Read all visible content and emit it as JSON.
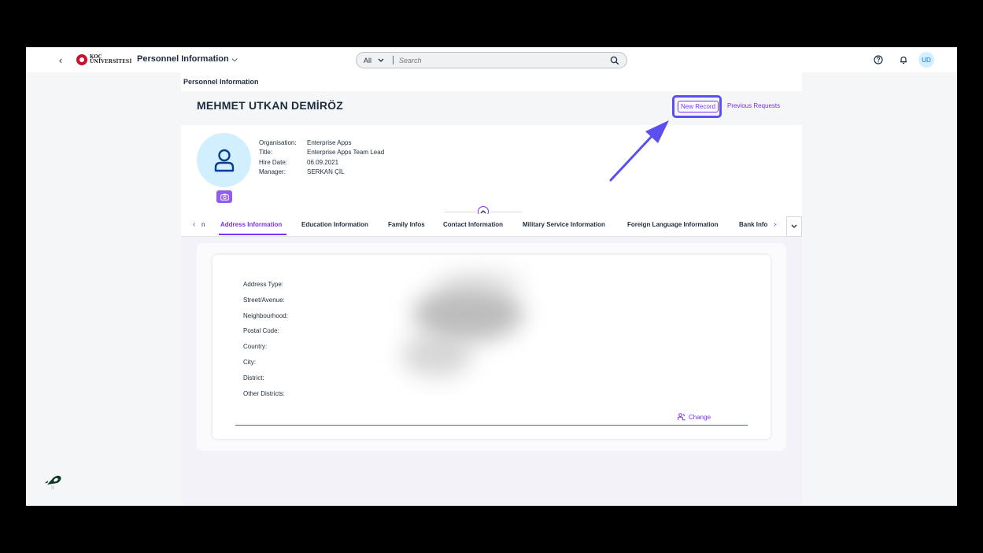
{
  "shell": {
    "logo_line1": "KOÇ",
    "logo_line2": "ÜNİVERSİTESİ",
    "app_title": "Personnel Information",
    "search_scope": "All",
    "search_placeholder": "Search",
    "avatar_initials": "UD"
  },
  "page": {
    "breadcrumb": "Personnel Information",
    "employee_name": "MEHMET UTKAN DEMİRÖZ",
    "actions": {
      "new_record": "New Record",
      "previous_requests": "Previous Requests"
    },
    "facts": [
      {
        "label": "Organisation:",
        "value": "Enterprise Apps"
      },
      {
        "label": "Title:",
        "value": "Enterprise Apps Team Lead"
      },
      {
        "label": "Hire Date:",
        "value": "06.09.2021"
      },
      {
        "label": "Manager:",
        "value": "SERKAN ÇİL"
      }
    ]
  },
  "tabs": {
    "prev_partial": "n",
    "items": [
      "Address Information",
      "Education Information",
      "Family Infos",
      "Contact Information",
      "Military Service Information",
      "Foreign Language Information",
      "Bank Info"
    ],
    "active_index": 0
  },
  "address": {
    "labels": [
      "Address Type:",
      "Street/Avenue:",
      "Neighbourhood:",
      "Postal Code:",
      "Country:",
      "City:",
      "District:",
      "Other Districts:"
    ],
    "change_label": "Change"
  },
  "colors": {
    "accent": "#7b2ff7",
    "annotation": "#5b4ff0",
    "avatar_bg": "#d1efff"
  }
}
